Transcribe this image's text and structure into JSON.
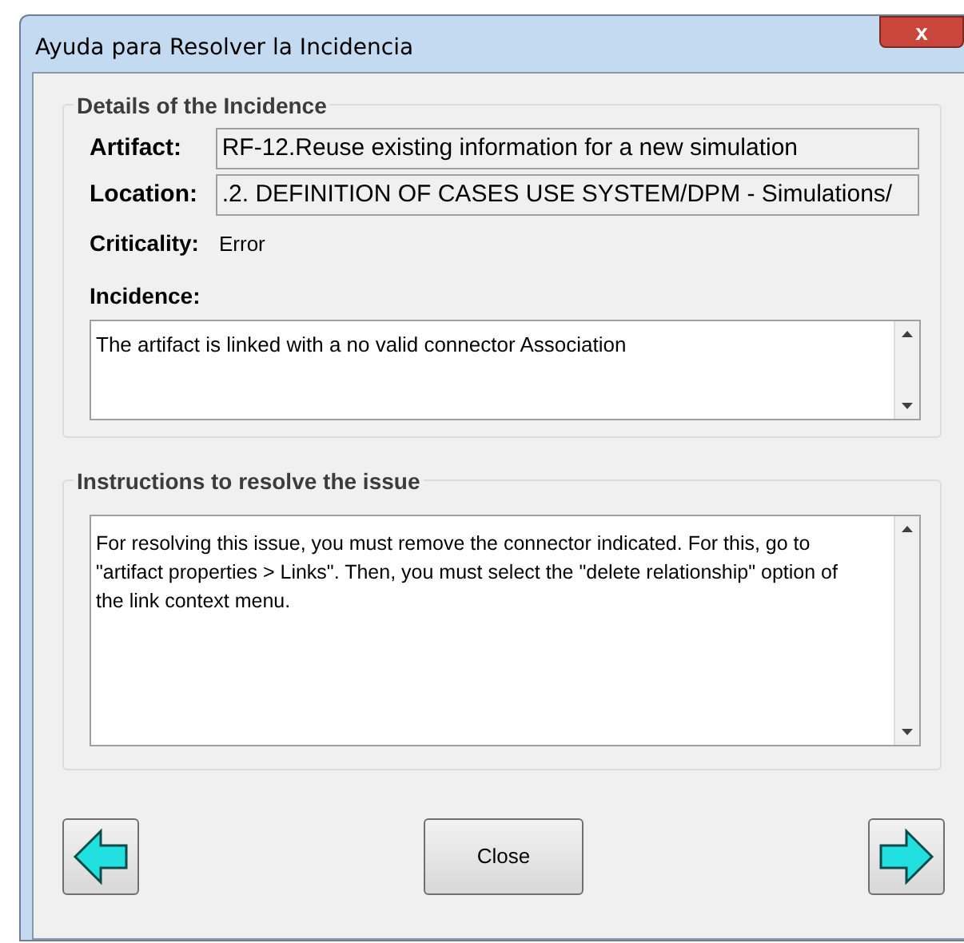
{
  "window": {
    "title": "Ayuda para Resolver la Incidencia",
    "close_glyph": "x"
  },
  "details": {
    "title": "Details of the Incidence",
    "fields": [
      {
        "label": "Artifact:",
        "value": "RF-12.Reuse existing information for a new simulation"
      },
      {
        "label": "Location:",
        "value": ".2. DEFINITION OF CASES USE SYSTEM/DPM - Simulations/"
      }
    ],
    "criticality": {
      "label": "Criticality:",
      "value": "Error"
    },
    "incidence": {
      "label": "Incidence:",
      "text": "The artifact is linked with a no valid connector Association"
    }
  },
  "instructions": {
    "title": "Instructions to resolve the issue",
    "text": "For resolving this issue, you must remove the connector indicated. For this, go to \"artifact properties > Links\". Then, you must select the \"delete relationship\" option of the link context menu."
  },
  "buttons": [
    {
      "kind": "previous"
    },
    {
      "kind": "close",
      "label": "Close"
    },
    {
      "kind": "next"
    }
  ]
}
